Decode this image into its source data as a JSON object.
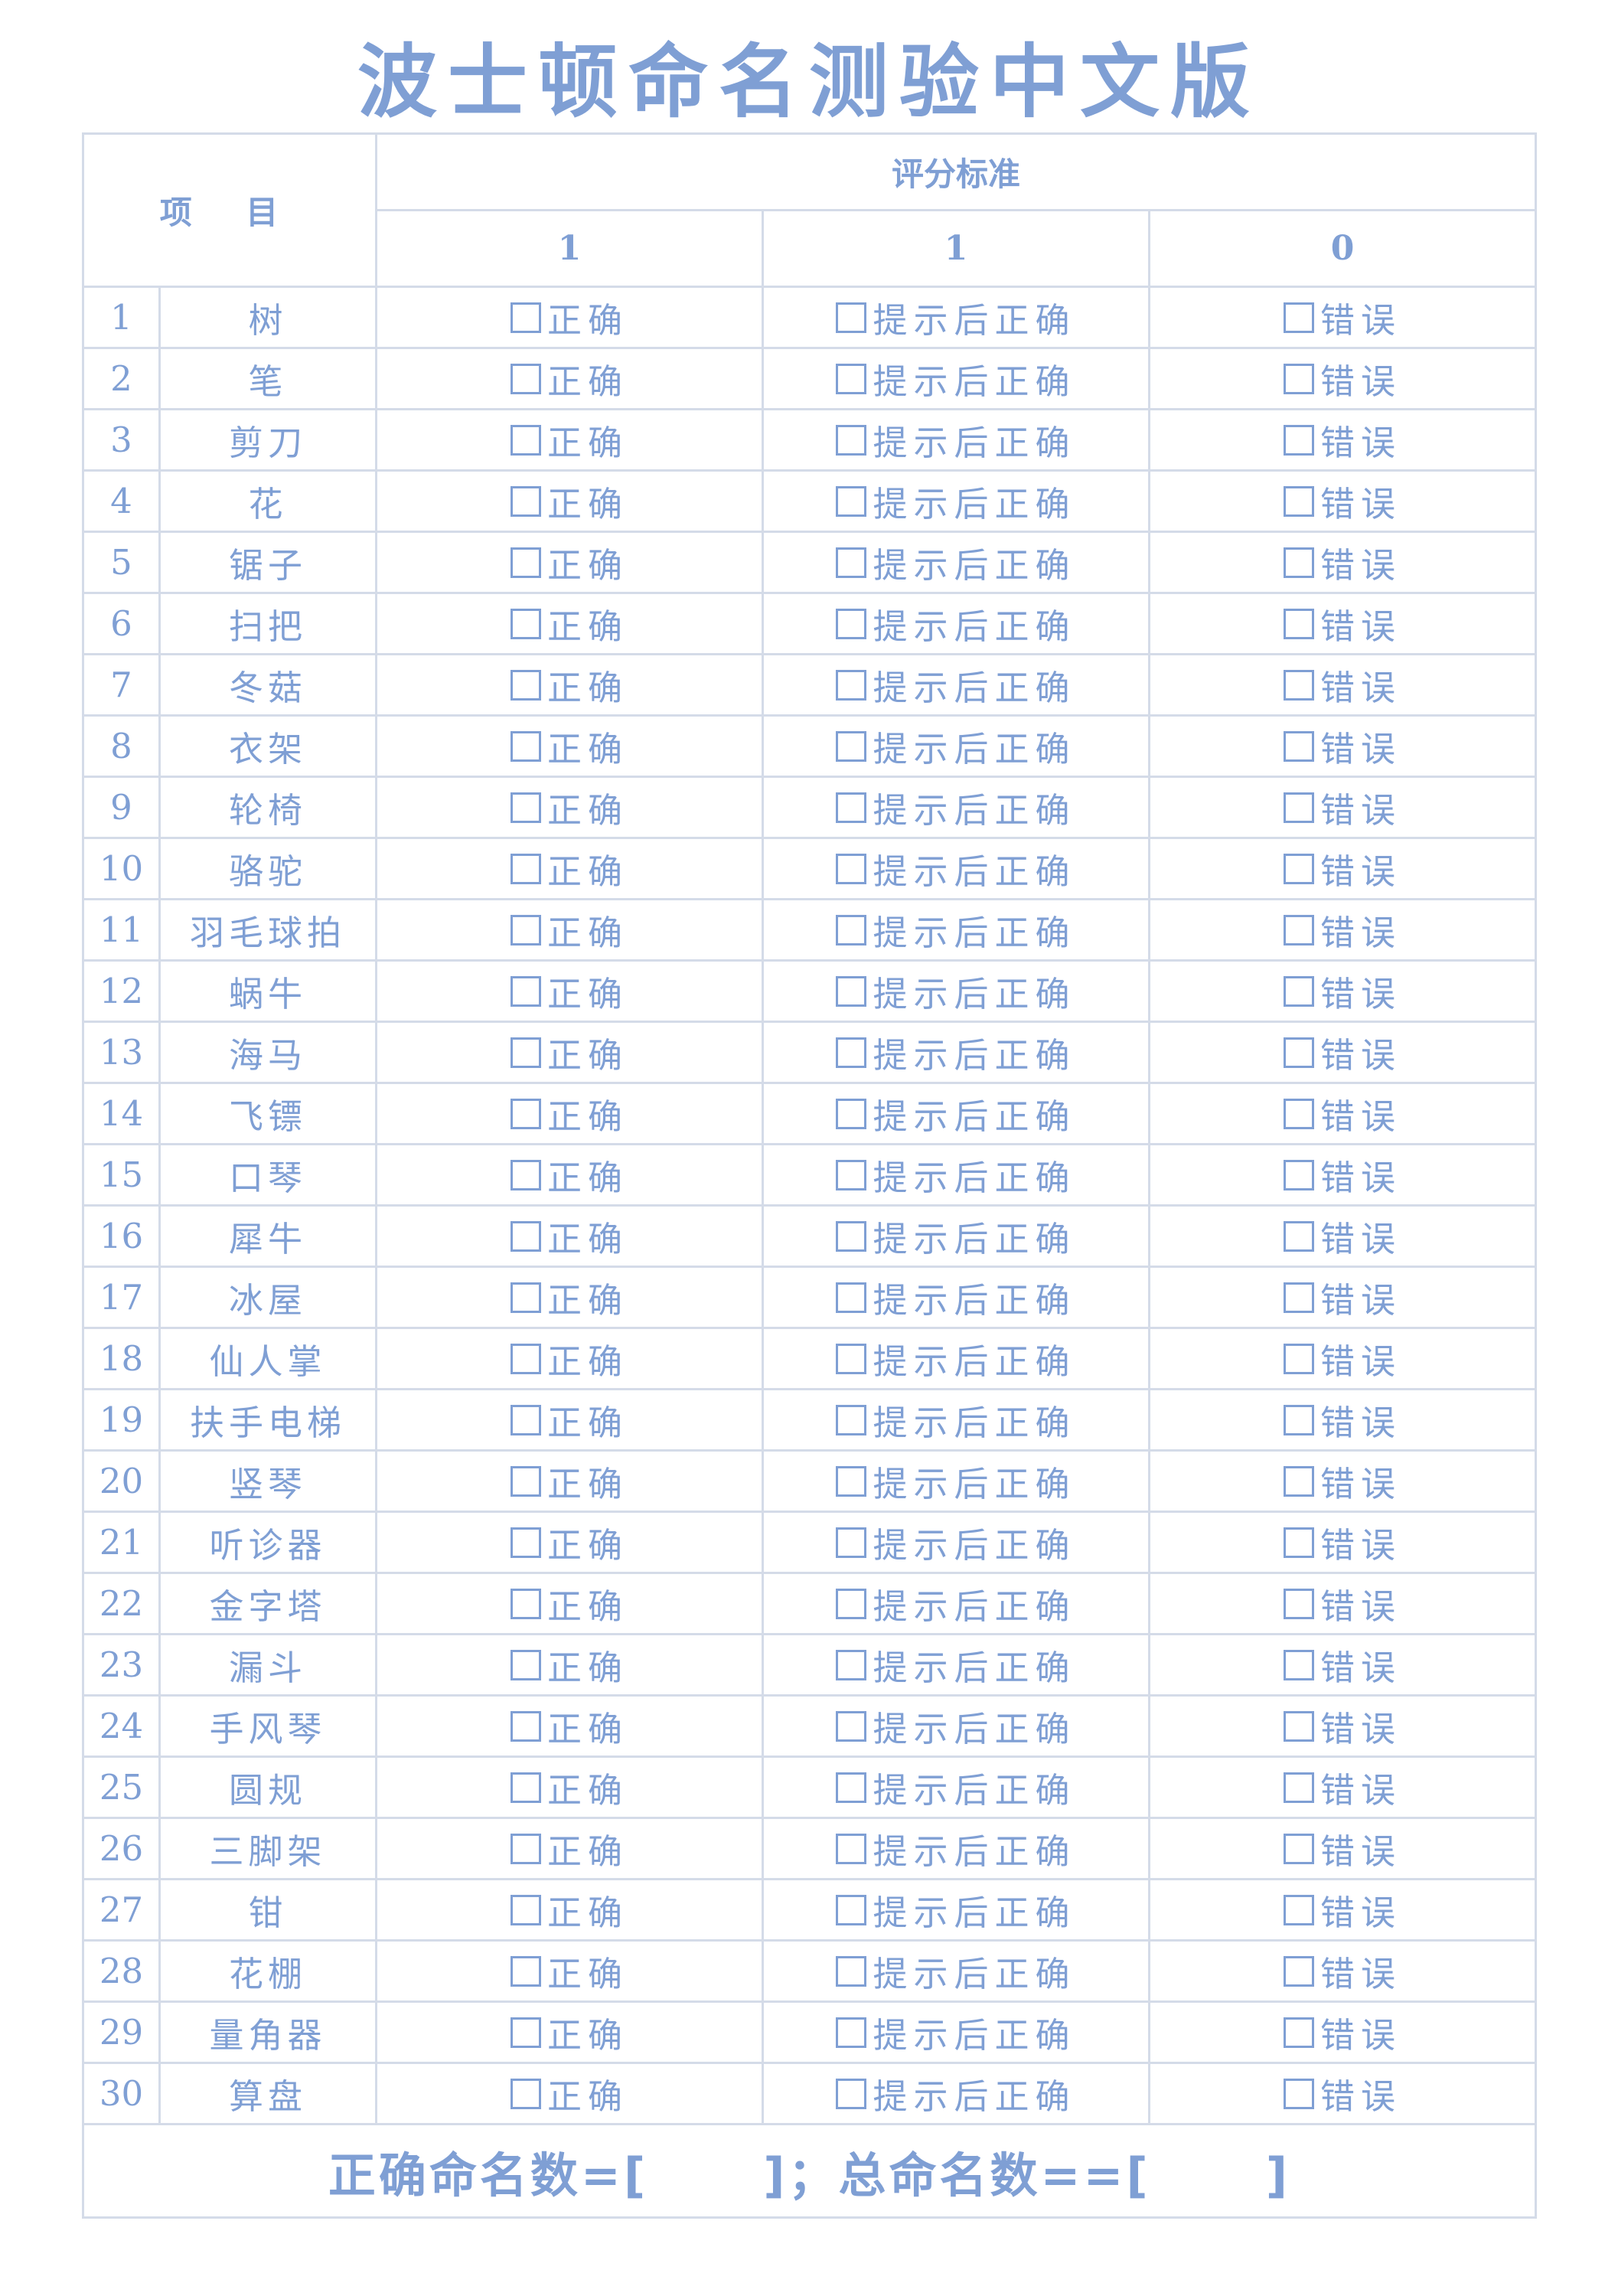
{
  "title": "波士顿命名测验中文版",
  "header": {
    "item_label": "项 目",
    "criteria_label": "评分标准",
    "scores": [
      "1",
      "1",
      "0"
    ]
  },
  "options": {
    "correct": "正确",
    "hint_correct": "提示后正确",
    "wrong": "错误"
  },
  "rows": [
    {
      "no": "1",
      "name": "树"
    },
    {
      "no": "2",
      "name": "笔"
    },
    {
      "no": "3",
      "name": "剪刀"
    },
    {
      "no": "4",
      "name": "花"
    },
    {
      "no": "5",
      "name": "锯子"
    },
    {
      "no": "6",
      "name": "扫把"
    },
    {
      "no": "7",
      "name": "冬菇"
    },
    {
      "no": "8",
      "name": "衣架"
    },
    {
      "no": "9",
      "name": "轮椅"
    },
    {
      "no": "10",
      "name": "骆驼"
    },
    {
      "no": "11",
      "name": "羽毛球拍"
    },
    {
      "no": "12",
      "name": "蜗牛"
    },
    {
      "no": "13",
      "name": "海马"
    },
    {
      "no": "14",
      "name": "飞镖"
    },
    {
      "no": "15",
      "name": "口琴"
    },
    {
      "no": "16",
      "name": "犀牛"
    },
    {
      "no": "17",
      "name": "冰屋"
    },
    {
      "no": "18",
      "name": "仙人掌"
    },
    {
      "no": "19",
      "name": "扶手电梯"
    },
    {
      "no": "20",
      "name": "竖琴"
    },
    {
      "no": "21",
      "name": "听诊器"
    },
    {
      "no": "22",
      "name": "金字塔"
    },
    {
      "no": "23",
      "name": "漏斗"
    },
    {
      "no": "24",
      "name": "手风琴"
    },
    {
      "no": "25",
      "name": "圆规"
    },
    {
      "no": "26",
      "name": "三脚架"
    },
    {
      "no": "27",
      "name": "钳"
    },
    {
      "no": "28",
      "name": "花棚"
    },
    {
      "no": "29",
      "name": "量角器"
    },
    {
      "no": "30",
      "name": "算盘"
    }
  ],
  "footer": {
    "correct_count_label": "正确命名数=[",
    "separator": "]；",
    "total_count_label": "总命名数==[",
    "close": "]"
  },
  "colors": {
    "text": "#7f9fd4",
    "border": "#d4dbe8"
  }
}
